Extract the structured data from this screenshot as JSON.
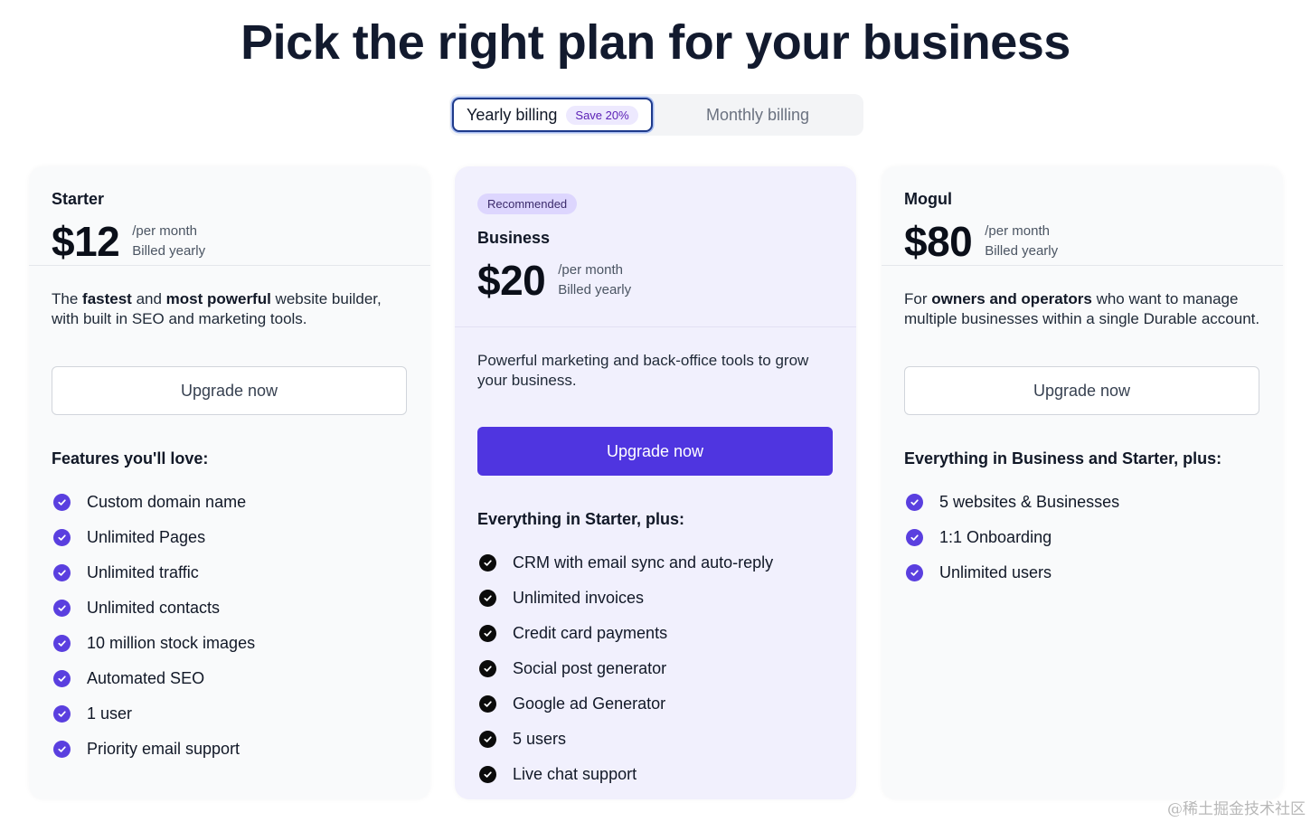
{
  "title": "Pick the right plan for your business",
  "billing": {
    "yearly_label": "Yearly billing",
    "save_badge": "Save 20%",
    "monthly_label": "Monthly billing"
  },
  "plans": {
    "starter": {
      "name": "Starter",
      "price": "$12",
      "per": "/per month",
      "billed": "Billed yearly",
      "desc_pre": "The ",
      "desc_b1": "fastest",
      "desc_mid": " and ",
      "desc_b2": "most powerful",
      "desc_post": " website builder, with built in SEO and marketing tools.",
      "cta": "Upgrade now",
      "features_title": "Features you'll love:",
      "features": [
        "Custom domain name",
        "Unlimited Pages",
        "Unlimited traffic",
        "Unlimited contacts",
        "10 million stock images",
        "Automated SEO",
        "1 user",
        "Priority email support"
      ]
    },
    "business": {
      "badge": "Recommended",
      "name": "Business",
      "price": "$20",
      "per": "/per month",
      "billed": "Billed yearly",
      "desc": "Powerful marketing and back-office tools to grow your business.",
      "cta": "Upgrade now",
      "features_title": "Everything in Starter, plus:",
      "features": [
        "CRM with email sync and auto-reply",
        "Unlimited invoices",
        "Credit card payments",
        "Social post generator",
        "Google ad Generator",
        "5 users",
        "Live chat support"
      ]
    },
    "mogul": {
      "name": "Mogul",
      "price": "$80",
      "per": "/per month",
      "billed": "Billed yearly",
      "desc_pre": "For ",
      "desc_b1": "owners and operators",
      "desc_post": " who want to manage multiple businesses within a single Durable account.",
      "cta": "Upgrade now",
      "features_title": "Everything in Business and Starter, plus:",
      "features": [
        "5 websites & Businesses",
        "1:1 Onboarding",
        "Unlimited users"
      ]
    }
  },
  "watermark": "@稀土掘金技术社区",
  "colors": {
    "accent": "#4f35e0",
    "check_starter": "#5a3fdf",
    "check_business": "#0b0b0b",
    "business_bg": "#f1f0fd"
  }
}
